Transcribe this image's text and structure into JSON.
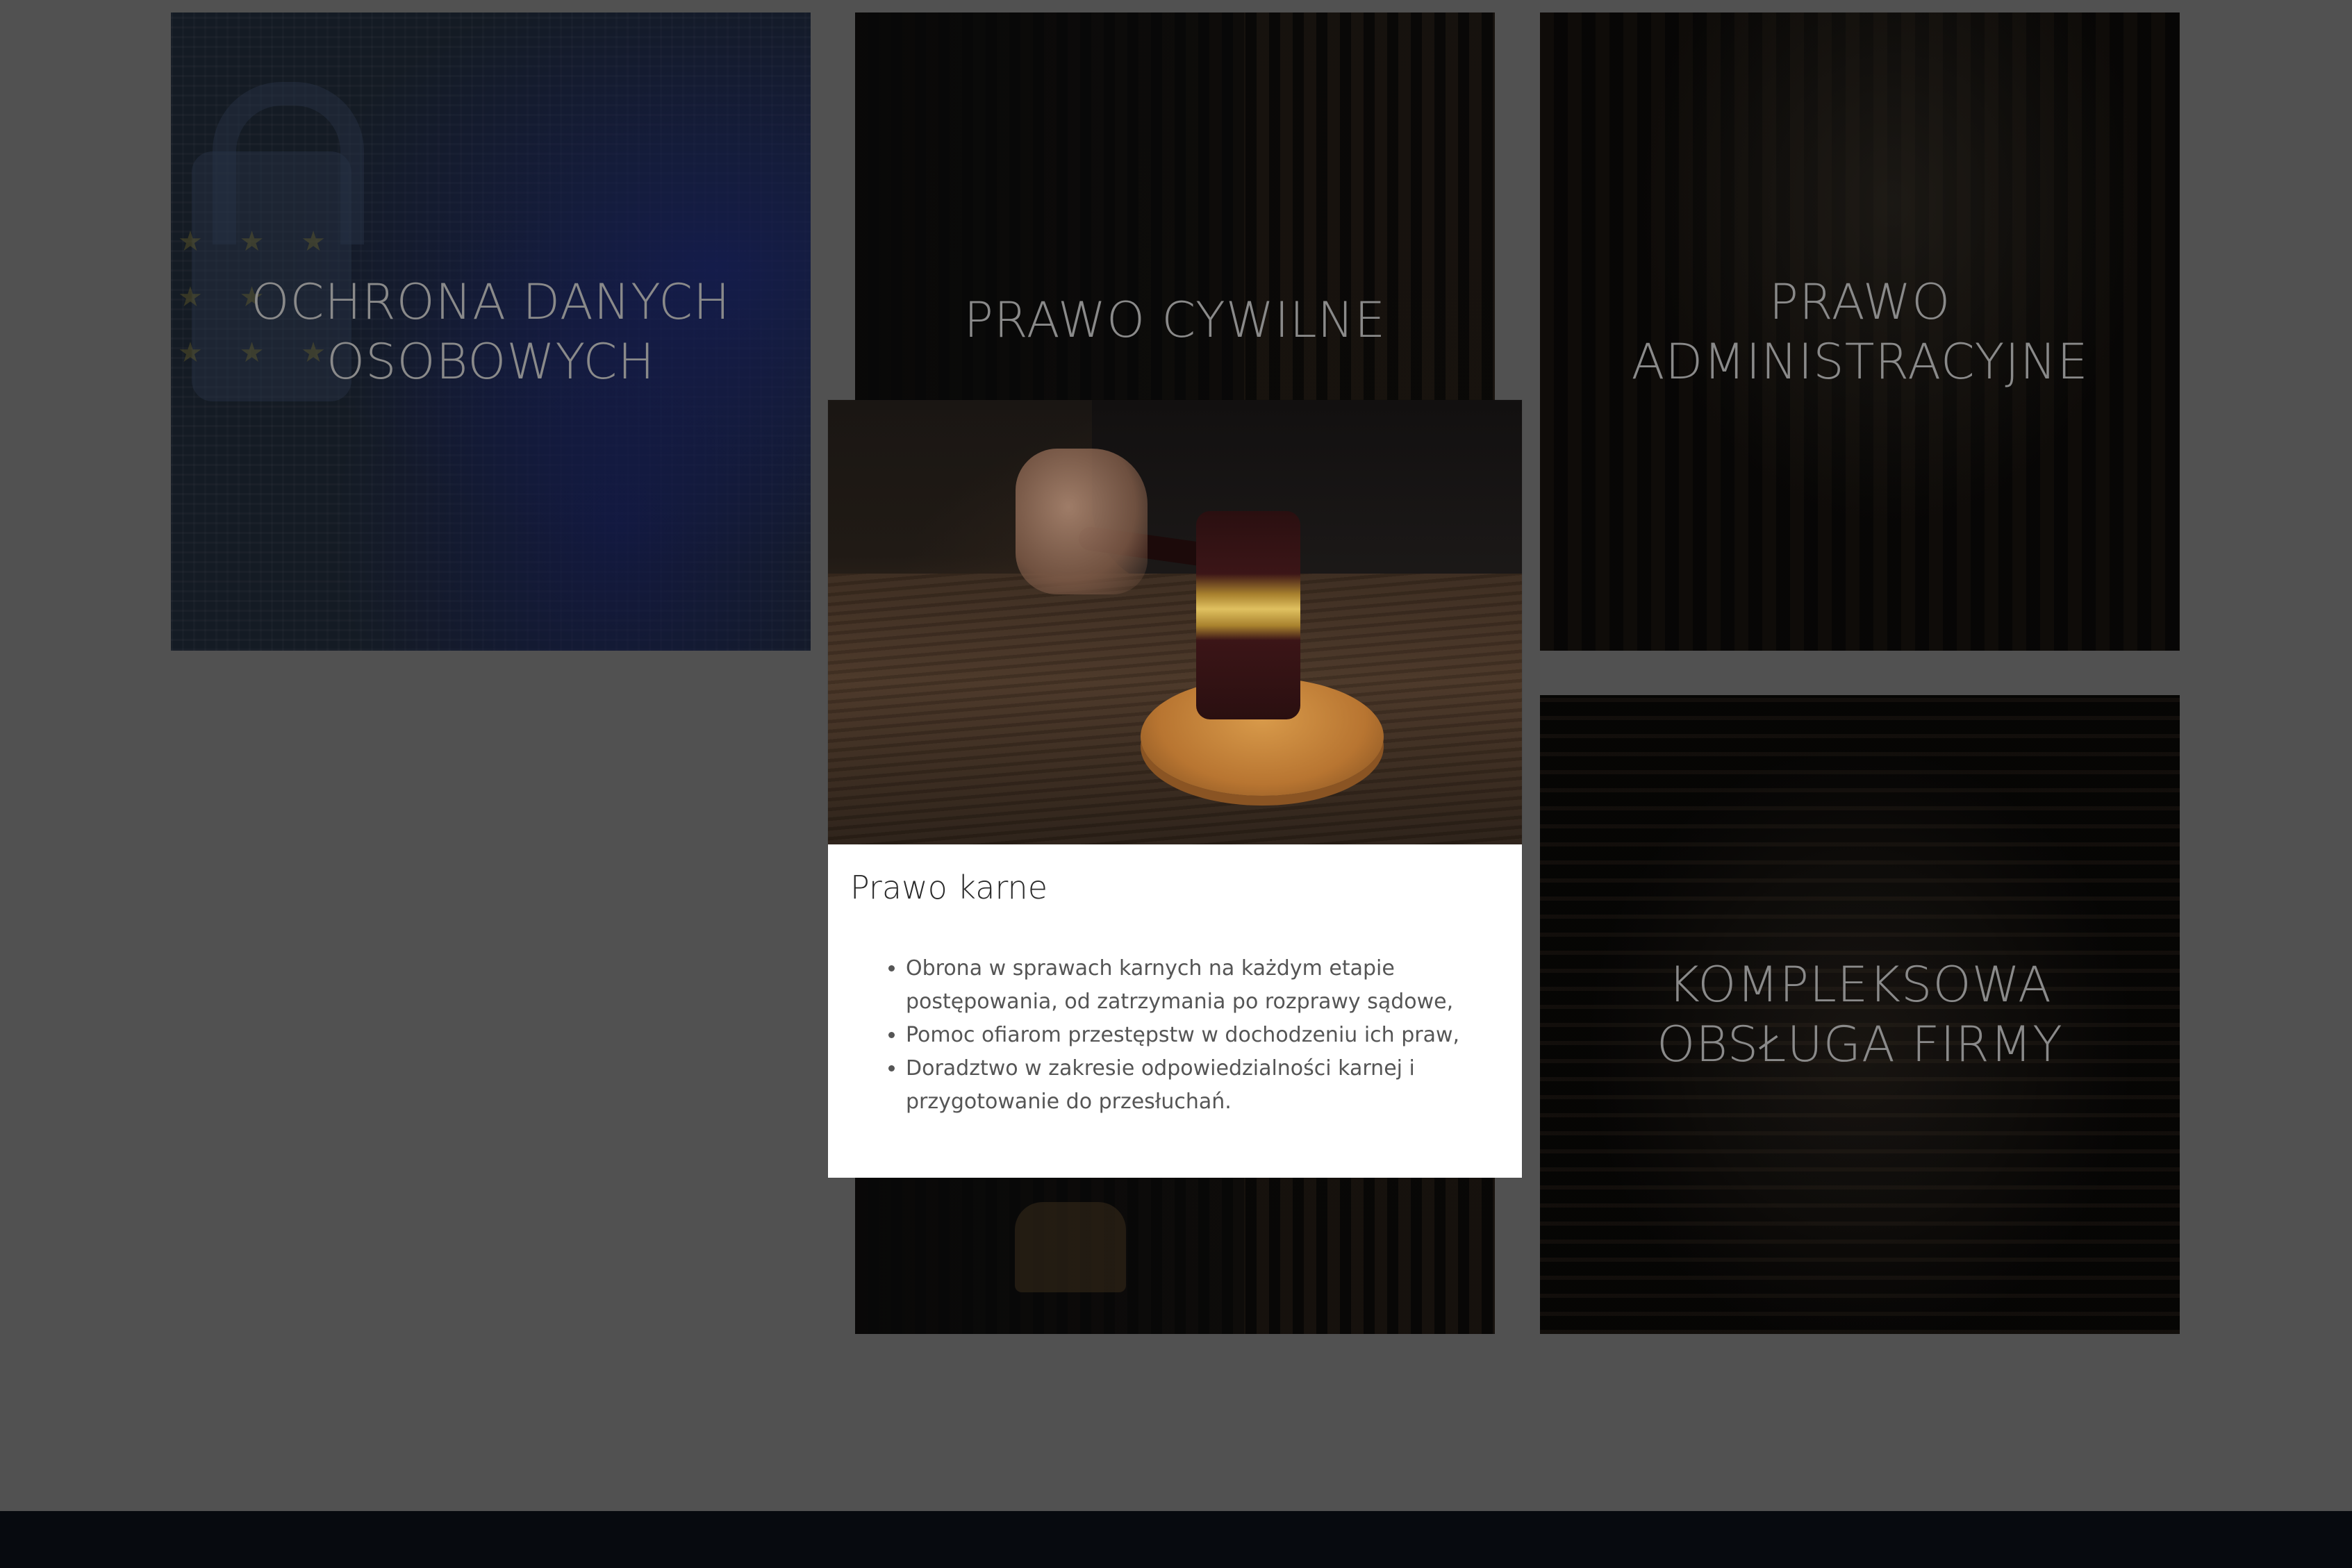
{
  "tiles": [
    {
      "title": "OCHRONA DANYCH\nOSOBOWYCH"
    },
    {
      "title": "PRAWO CYWILNE"
    },
    {
      "title": "PRAWO\nADMINISTRACYJNE"
    },
    {
      "title": "KOMPLEKSOWA\nOBSŁUGA FIRMY"
    }
  ],
  "card": {
    "title": "Prawo karne",
    "items": [
      "Obrona w sprawach karnych na każdym etapie postępowania, od zatrzymania po rozprawy sądowe,",
      "Pomoc ofiarom przestępstw w dochodzeniu ich praw,",
      "Doradztwo w zakresie odpowiedzialności karnej i przygotowanie do przesłuchań."
    ]
  },
  "colors": {
    "page_background": "#515151",
    "footer_background": "#070a0f",
    "tile_title": "#8a8a8a"
  }
}
